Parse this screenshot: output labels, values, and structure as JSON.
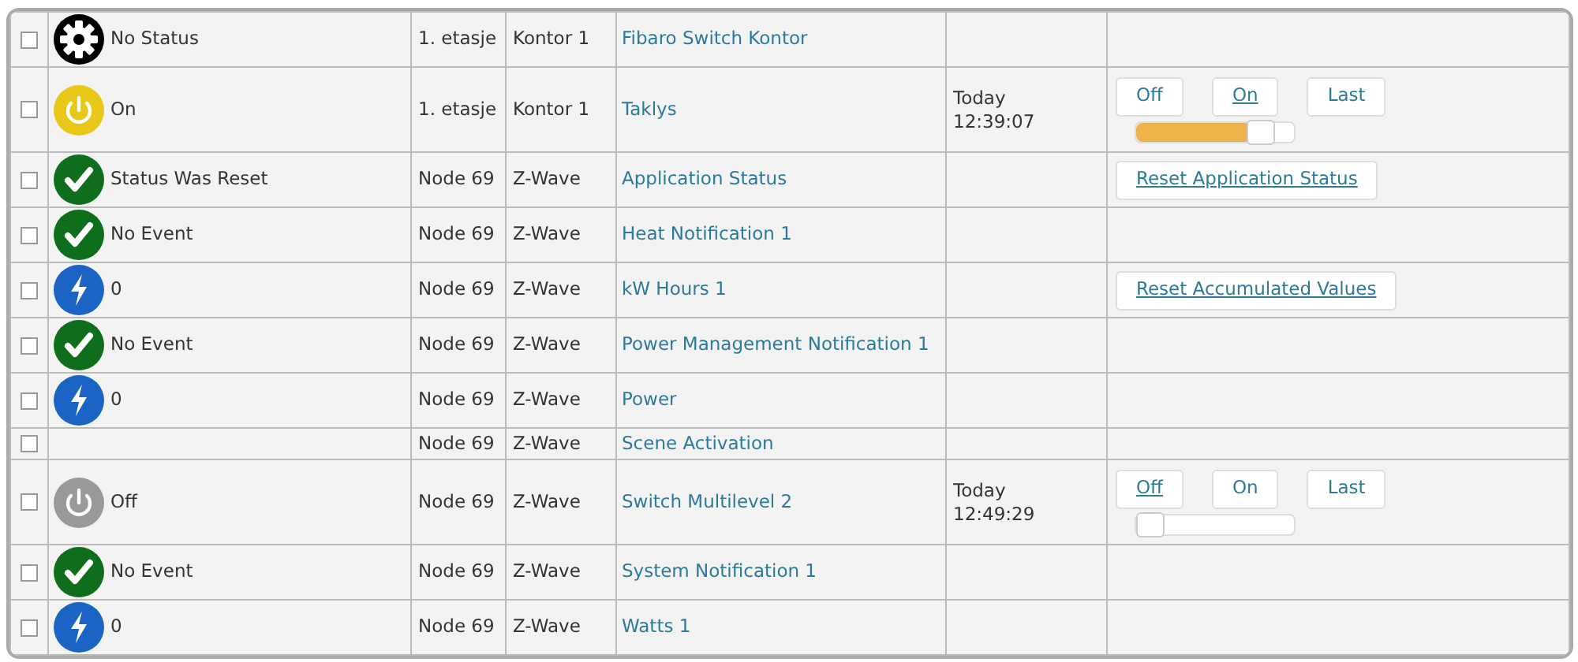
{
  "rows": [
    {
      "checked": false,
      "kind": "gear",
      "status": "No Status",
      "location": "1. etasje",
      "room": "Kontor 1",
      "name": "Fibaro Switch Kontor"
    },
    {
      "checked": false,
      "kind": "power_on",
      "status": "On",
      "location": "1. etasje",
      "room": "Kontor 1",
      "name": "Taklys",
      "time": [
        "Today",
        "12:39:07"
      ],
      "action": {
        "kind": "switch",
        "buttons": [
          {
            "label": "Off",
            "selected": false
          },
          {
            "label": "On",
            "selected": true
          },
          {
            "label": "Last",
            "selected": false
          }
        ],
        "level": 0.85
      }
    },
    {
      "checked": false,
      "kind": "check",
      "status": "Status Was Reset",
      "location": "Node 69",
      "room": "Z-Wave",
      "name": "Application Status",
      "action": {
        "kind": "reset",
        "label": "Reset Application Status"
      }
    },
    {
      "checked": false,
      "kind": "check",
      "status": "No Event",
      "location": "Node 69",
      "room": "Z-Wave",
      "name": "Heat Notification 1"
    },
    {
      "checked": false,
      "kind": "bolt",
      "status": "0",
      "location": "Node 69",
      "room": "Z-Wave",
      "name": "kW Hours 1",
      "action": {
        "kind": "reset",
        "label": "Reset Accumulated Values"
      }
    },
    {
      "checked": false,
      "kind": "check",
      "status": "No Event",
      "location": "Node 69",
      "room": "Z-Wave",
      "name": "Power Management Notification 1"
    },
    {
      "checked": false,
      "kind": "bolt",
      "status": "0",
      "location": "Node 69",
      "room": "Z-Wave",
      "name": "Power"
    },
    {
      "checked": false,
      "location": "Node 69",
      "room": "Z-Wave",
      "name": "Scene Activation"
    },
    {
      "checked": false,
      "kind": "power_off",
      "status": "Off",
      "location": "Node 69",
      "room": "Z-Wave",
      "name": "Switch Multilevel 2",
      "time": [
        "Today",
        "12:49:29"
      ],
      "action": {
        "kind": "switch",
        "buttons": [
          {
            "label": "Off",
            "selected": true
          },
          {
            "label": "On",
            "selected": false
          },
          {
            "label": "Last",
            "selected": false
          }
        ],
        "level": 0
      }
    },
    {
      "checked": false,
      "kind": "check",
      "status": "No Event",
      "location": "Node 69",
      "room": "Z-Wave",
      "name": "System Notification 1"
    },
    {
      "checked": false,
      "kind": "bolt",
      "status": "0",
      "location": "Node 69",
      "room": "Z-Wave",
      "name": "Watts 1"
    }
  ]
}
